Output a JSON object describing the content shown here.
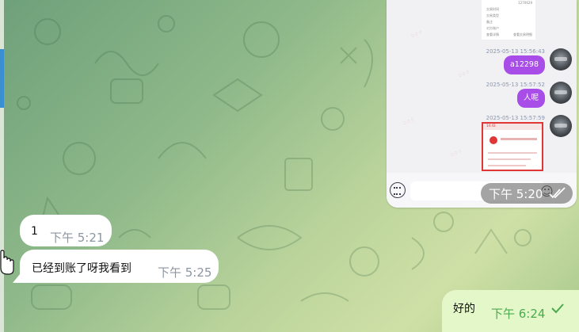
{
  "chat": {
    "forwarded_image": {
      "card_lines": [
        [
          "",
          "1270629"
        ],
        [
          "交易时间",
          ""
        ],
        [
          "交易类型",
          ""
        ],
        [
          "备注",
          ""
        ],
        [
          "对方账户",
          ""
        ],
        [
          "查看详情",
          "查看交易明细"
        ]
      ],
      "messages": [
        {
          "timestamp": "2025-05-13 15:56:43",
          "text": "a12298"
        },
        {
          "timestamp": "2025-05-13 15:57:52",
          "text": "人呢"
        },
        {
          "timestamp": "2025-05-13 15:57:59",
          "text": ""
        }
      ],
      "receipt_header": "14:43",
      "receipt_bank": "建设银行",
      "time_overlay": "下午 5:20"
    },
    "incoming": [
      {
        "text": "1",
        "time": "下午 5:21"
      },
      {
        "text": "已经到账了呀我看到",
        "time": "下午 5:25"
      }
    ],
    "outgoing": [
      {
        "text": "好的",
        "time": "下午 6:24"
      }
    ]
  },
  "colors": {
    "accent_blue": "#3a8fd0",
    "outgoing_bubble": "#e3f7c9",
    "outgoing_time": "#4caa4e",
    "purple_message": "#a84de8",
    "incoming_time": "#8c96a1"
  },
  "icons": [
    "keyboard-icon",
    "emoji-icon",
    "double-check-icon",
    "single-check-icon",
    "hand-cursor-icon"
  ]
}
